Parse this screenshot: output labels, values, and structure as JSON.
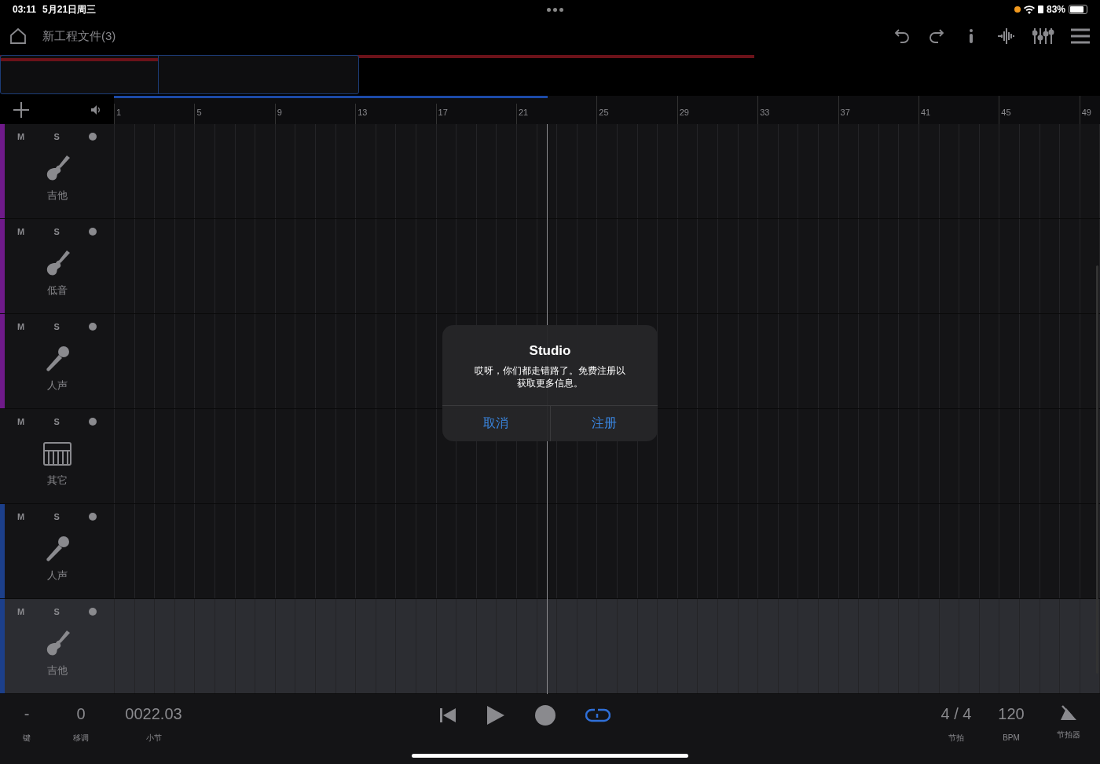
{
  "status_bar": {
    "time": "03:11",
    "date": "5月21日周三",
    "battery": "83%"
  },
  "toolbar": {
    "project_title": "新工程文件(3)"
  },
  "ruler": {
    "bars": [
      "1",
      "5",
      "9",
      "13",
      "17",
      "21",
      "25",
      "29",
      "33",
      "37",
      "41",
      "45",
      "49"
    ]
  },
  "tracks": [
    {
      "name": "吉他",
      "kind": "guitar",
      "color": "#6f1a8a",
      "selected": false,
      "mute": "M",
      "solo": "S"
    },
    {
      "name": "低音",
      "kind": "bass",
      "color": "#6f1a8a",
      "selected": false,
      "mute": "M",
      "solo": "S"
    },
    {
      "name": "人声",
      "kind": "vocal",
      "color": "#6f1a8a",
      "selected": false,
      "mute": "M",
      "solo": "S"
    },
    {
      "name": "其它",
      "kind": "keys",
      "selected": false,
      "mute": "M",
      "solo": "S"
    },
    {
      "name": "人声",
      "kind": "vocal",
      "color": "#1c3f8a",
      "selected": false,
      "mute": "M",
      "solo": "S"
    },
    {
      "name": "吉他",
      "kind": "guitar",
      "color": "#1c3f8a",
      "selected": true,
      "mute": "M",
      "solo": "S"
    }
  ],
  "dialog": {
    "title": "Studio",
    "message": "哎呀，你们都走错路了。免费注册以获取更多信息。",
    "buttons": [
      "取消",
      "注册"
    ]
  },
  "transport": {
    "key": {
      "value": "-",
      "label": "键"
    },
    "transpose": {
      "value": "0",
      "label": "移调"
    },
    "position": {
      "value": "0022.03",
      "label": "小节"
    },
    "loop": {
      "on": true
    },
    "time_signature": {
      "value": "4 / 4",
      "label": "节拍"
    },
    "tempo": {
      "value": "120",
      "label": "BPM"
    },
    "metronome": {
      "label": "节拍器"
    }
  }
}
